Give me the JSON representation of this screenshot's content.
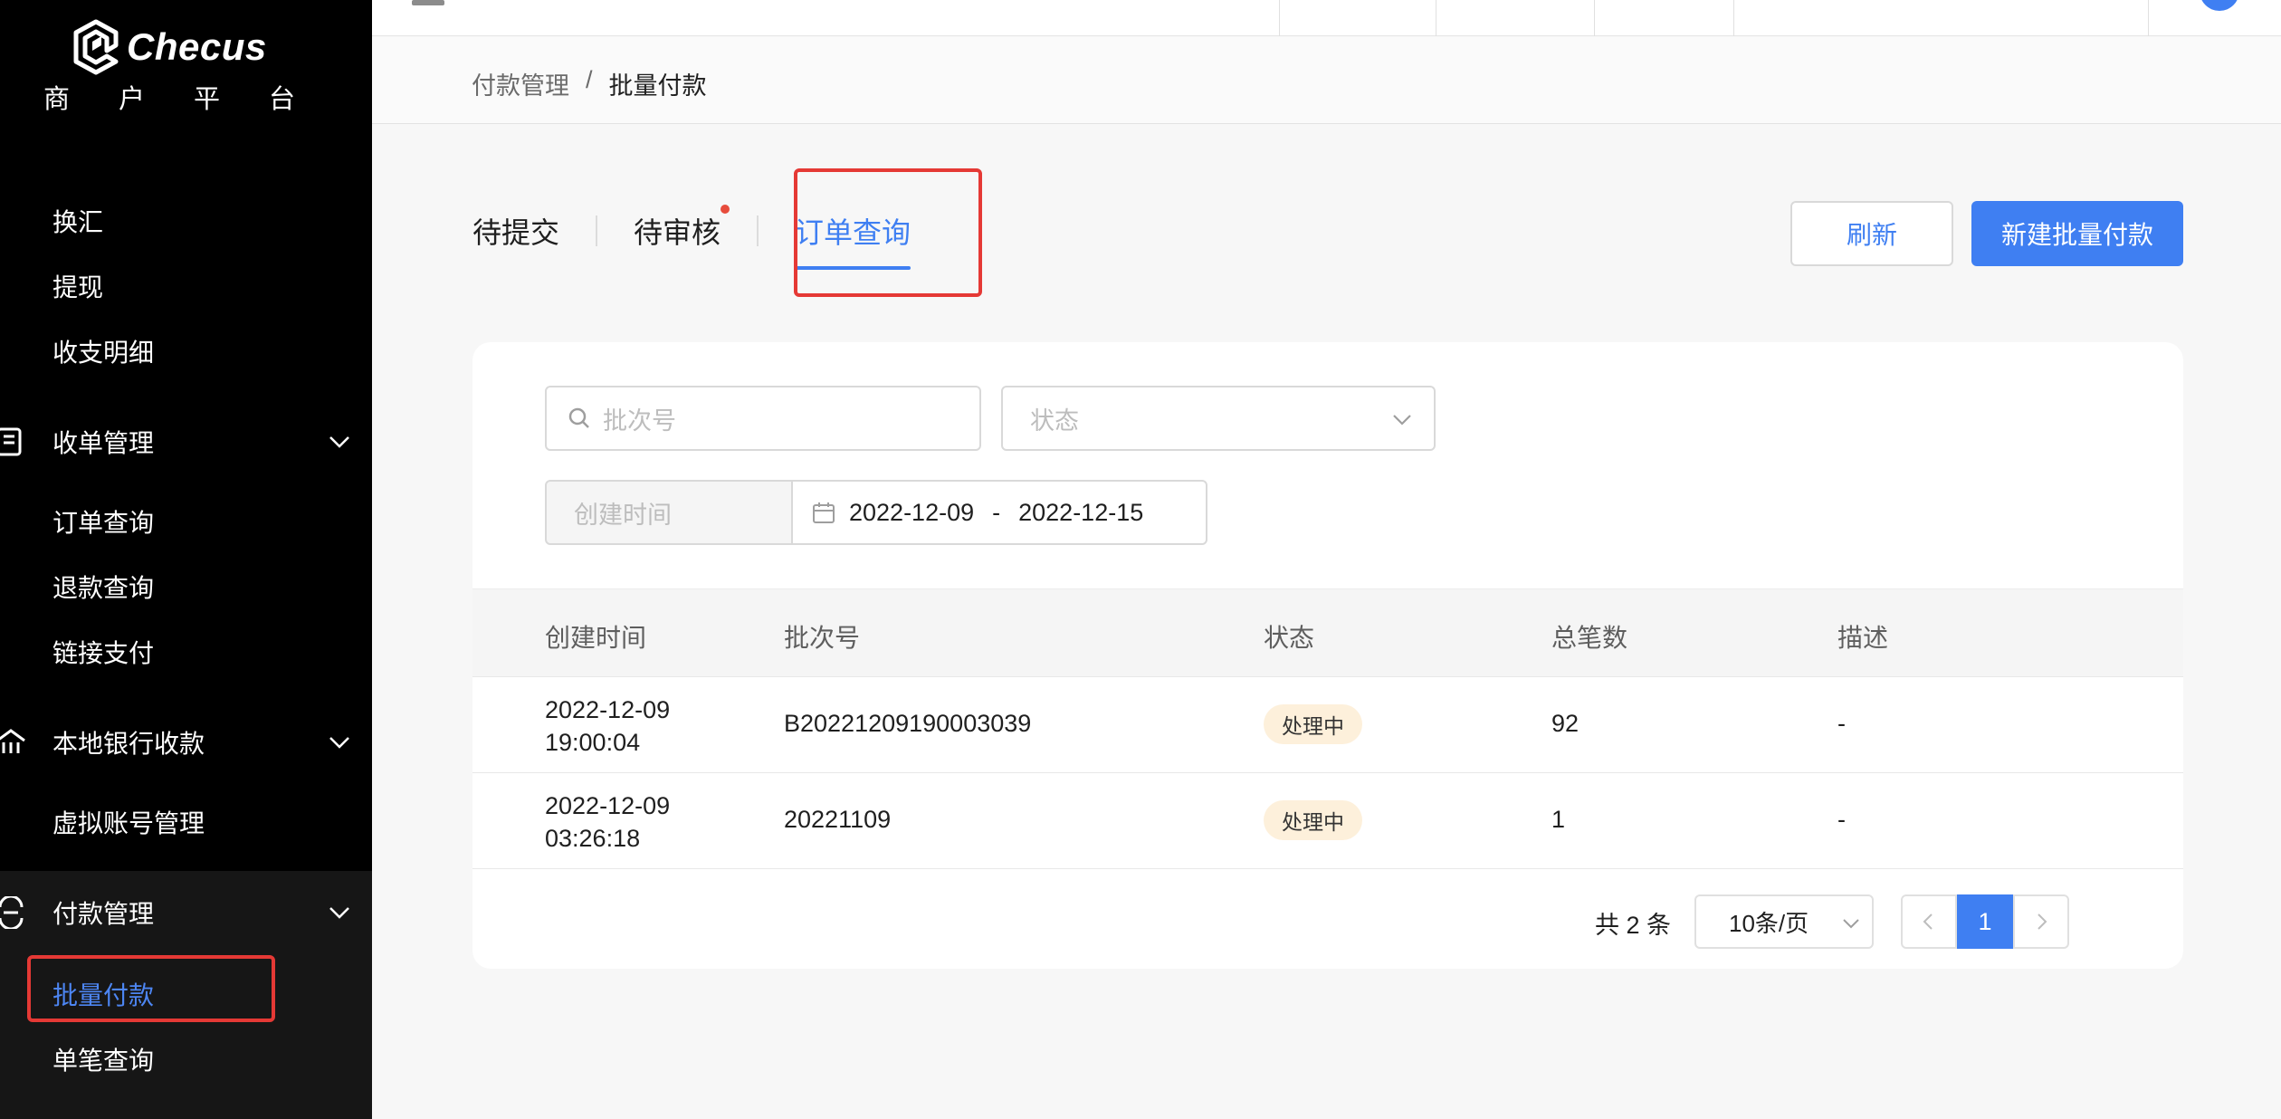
{
  "brand": {
    "name": "Checus",
    "subtitle_chars": [
      "商",
      "户",
      "平",
      "台"
    ]
  },
  "sidebar": {
    "items_top": [
      "换汇",
      "提现",
      "收支明细"
    ],
    "group_orders": {
      "label": "收单管理",
      "items": [
        "订单查询",
        "退款查询",
        "链接支付"
      ]
    },
    "group_bank": {
      "label": "本地银行收款",
      "items": [
        "虚拟账号管理"
      ]
    },
    "group_payment": {
      "label": "付款管理",
      "items": [
        "批量付款",
        "单笔查询"
      ],
      "active": "批量付款"
    }
  },
  "breadcrumb": {
    "parent": "付款管理",
    "separator": "/",
    "current": "批量付款"
  },
  "tabs": {
    "pending_submit": "待提交",
    "pending_review": "待审核",
    "order_query": "订单查询"
  },
  "buttons": {
    "refresh": "刷新",
    "new_batch": "新建批量付款"
  },
  "filters": {
    "batch_placeholder": "批次号",
    "status_placeholder": "状态",
    "date_label": "创建时间",
    "date_start": "2022-12-09",
    "date_separator": "-",
    "date_end": "2022-12-15"
  },
  "table": {
    "headers": {
      "created": "创建时间",
      "batch_no": "批次号",
      "status": "状态",
      "total": "总笔数",
      "desc": "描述"
    },
    "rows": [
      {
        "date": "2022-12-09",
        "time": "19:00:04",
        "batch_no": "B20221209190003039",
        "status": "处理中",
        "total": "92",
        "desc": "-"
      },
      {
        "date": "2022-12-09",
        "time": "03:26:18",
        "batch_no": "20221109",
        "status": "处理中",
        "total": "1",
        "desc": "-"
      }
    ]
  },
  "pagination": {
    "total": "共 2 条",
    "page_size": "10条/页",
    "current_page": "1"
  },
  "colors": {
    "accent": "#3f7ff2",
    "annotation": "#e53935",
    "sidebar_bg": "#000000"
  }
}
